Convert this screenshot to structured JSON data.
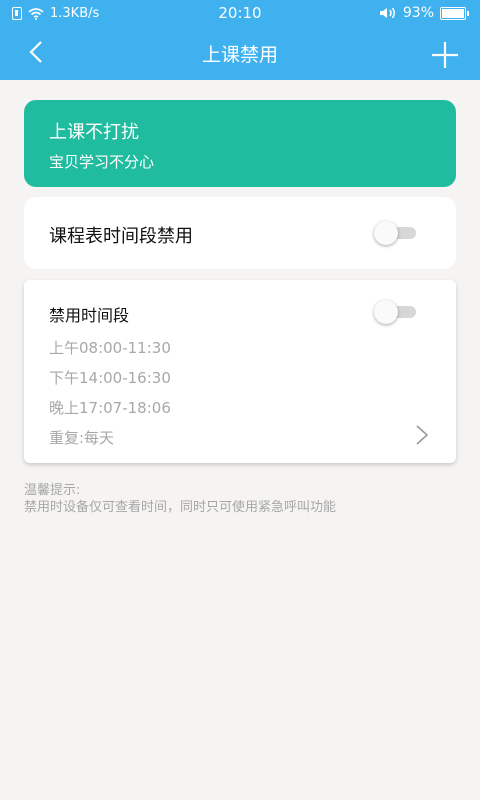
{
  "status_bar": {
    "network_speed": "1.3KB/s",
    "time": "20:10",
    "battery": "93%"
  },
  "nav": {
    "title": "上课禁用"
  },
  "banner": {
    "title": "上课不打扰",
    "subtitle": "宝贝学习不分心"
  },
  "schedule_toggle": {
    "label": "课程表时间段禁用",
    "enabled": false
  },
  "period_card": {
    "label": "禁用时间段",
    "enabled": false,
    "slots": [
      "上午08:00-11:30",
      "下午14:00-16:30",
      "晚上17:07-18:06"
    ],
    "repeat": "重复:每天"
  },
  "tips": {
    "heading": "温馨提示:",
    "text": "禁用时设备仅可查看时间，同时只可使用紧急呼叫功能"
  },
  "colors": {
    "header": "#3fb1ef",
    "banner": "#1fbc9f",
    "background": "#f5f4f2"
  }
}
